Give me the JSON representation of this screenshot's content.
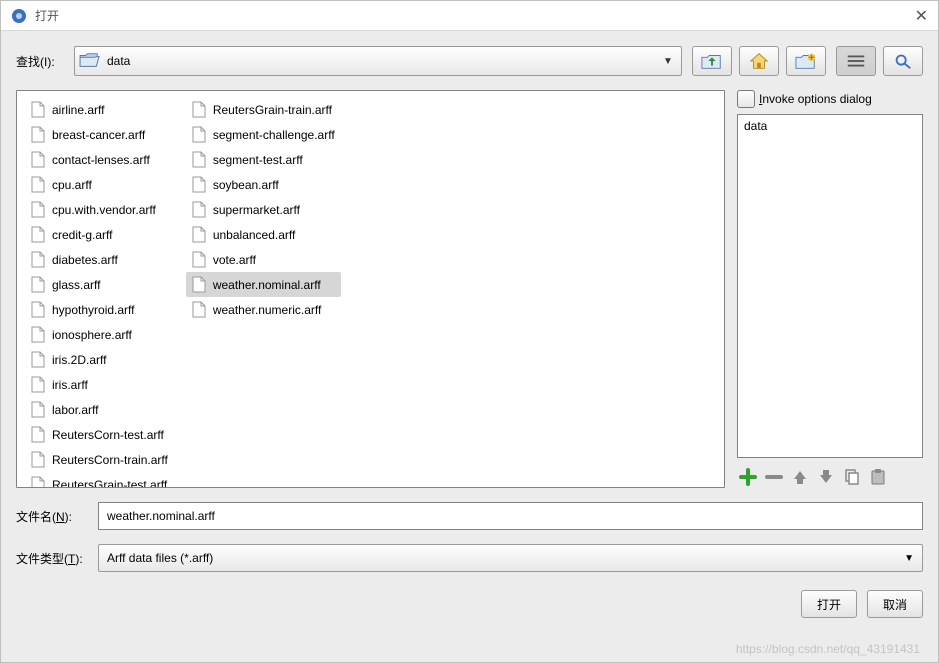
{
  "window": {
    "title": "打开"
  },
  "lookin": {
    "label": "查找(I):",
    "value": "data"
  },
  "files": {
    "col1": [
      "airline.arff",
      "breast-cancer.arff",
      "contact-lenses.arff",
      "cpu.arff",
      "cpu.with.vendor.arff",
      "credit-g.arff",
      "diabetes.arff",
      "glass.arff",
      "hypothyroid.arff",
      "ionosphere.arff",
      "iris.2D.arff",
      "iris.arff",
      "labor.arff",
      "ReutersCorn-test.arff",
      "ReutersCorn-train.arff",
      "ReutersGrain-test.arff"
    ],
    "col2": [
      "ReutersGrain-train.arff",
      "segment-challenge.arff",
      "segment-test.arff",
      "soybean.arff",
      "supermarket.arff",
      "unbalanced.arff",
      "vote.arff",
      "weather.nominal.arff",
      "weather.numeric.arff"
    ],
    "selected": "weather.nominal.arff"
  },
  "side": {
    "invoke_label_prefix": "",
    "invoke_label_u": "I",
    "invoke_label_suffix": "nvoke options dialog",
    "list_item": "data"
  },
  "filename": {
    "label_prefix": "文件名(",
    "label_u": "N",
    "label_suffix": "):",
    "value": "weather.nominal.arff"
  },
  "filetype": {
    "label_prefix": "文件类型(",
    "label_u": "T",
    "label_suffix": "):",
    "value": "Arff data files (*.arff)"
  },
  "buttons": {
    "open": "打开",
    "cancel": "取消"
  },
  "watermark": "https://blog.csdn.net/qq_43191431"
}
